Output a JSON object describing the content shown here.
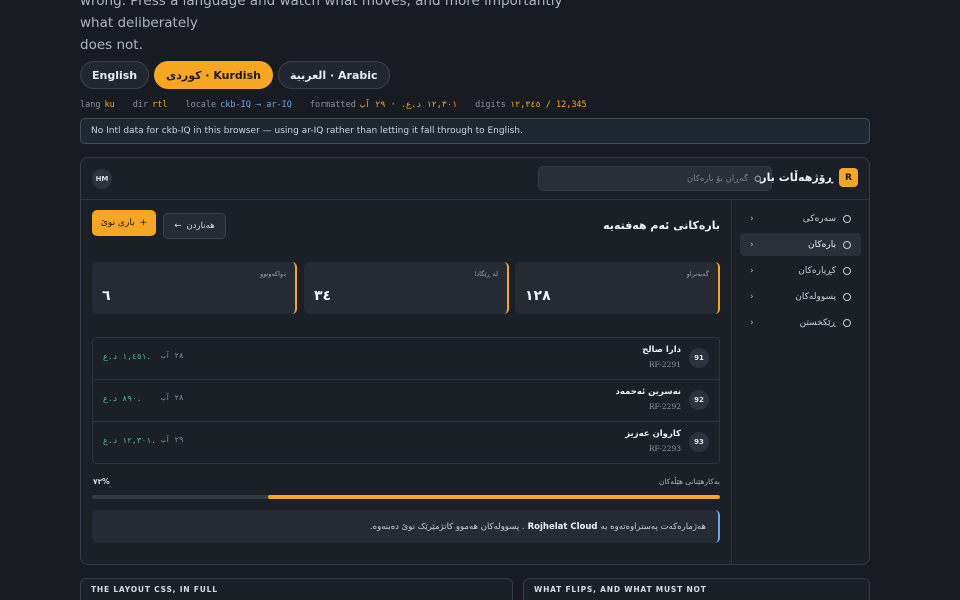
{
  "intro": {
    "line1": "wrong. Press a language and watch what moves, and more importantly what deliberately",
    "line2": "does not."
  },
  "languages": [
    {
      "label": "English",
      "active": false
    },
    {
      "label": "کوردی · Kurdish",
      "active": true
    },
    {
      "label": "العربية · Arabic",
      "active": false
    }
  ],
  "status": {
    "lang_key": "lang",
    "lang_val": "ku",
    "dir_key": "dir",
    "dir_val": "rtl",
    "locale_key": "locale",
    "locale_val": "ckb-IQ → ar-IQ",
    "formatted_key": "formatted",
    "formatted_val": "١٢,٣٠١ د.ع. · ٢٩ آب",
    "digits_key": "digits",
    "digits_val": "١٢,٣٤٥ / 12,345"
  },
  "notice": "No Intl data for ckb-IQ in this browser — using ar-IQ rather than letting it fall through to English.",
  "app": {
    "brand_logo": "R",
    "brand_name": "ڕۆژهەڵات بار",
    "search_placeholder": "گەڕان بۆ بارەکان",
    "avatar": "HM",
    "nav": [
      {
        "label": "سەرەکی",
        "active": false
      },
      {
        "label": "بارەکان",
        "active": true
      },
      {
        "label": "کڕیارەکان",
        "active": false
      },
      {
        "label": "پسوولەکان",
        "active": false
      },
      {
        "label": "ڕێکخستن",
        "active": false
      }
    ],
    "page_title": "بارەکانی ئەم هەفتەیە",
    "new_button": "باری نوێ",
    "export_button": "هەناردن",
    "stats": [
      {
        "label": "گەیەنراو",
        "value": "١٢٨"
      },
      {
        "label": "لە ڕێگادا",
        "value": "٣٤"
      },
      {
        "label": "دواکەوتوو",
        "value": "٦"
      }
    ],
    "rows": [
      {
        "badge": "91",
        "name": "دارا صالح",
        "ref": "RF-2291",
        "date": "٢٨ آب",
        "amount": "١,٤٥١ د.ع."
      },
      {
        "badge": "92",
        "name": "نەسرین ئەحمەد",
        "ref": "RF-2292",
        "date": "٢٨ آب",
        "amount": "٨٩٠ د.ع."
      },
      {
        "badge": "93",
        "name": "کاروان عەزیز",
        "ref": "RF-2293",
        "date": "٢٩ آب",
        "amount": "١٢,٣٠١ د.ع."
      }
    ],
    "progress": {
      "label": "بەکارهێنانی هێڵەکان",
      "percent_text": "٧٢%",
      "value": 0.72
    },
    "info": {
      "before": "هەژمارەکەت پەستراوەتەوە بە",
      "strong": "Rojhelat Cloud",
      "after": ". پسوولەکان هەموو کاتژمێرێک نوێ دەبنەوە."
    }
  },
  "cards": [
    {
      "title": "THE LAYOUT CSS, IN FULL"
    },
    {
      "title": "WHAT FLIPS, AND WHAT MUST NOT"
    }
  ],
  "colors": {
    "accent": "#f5a623",
    "info": "#6aa6f0",
    "money": "#4fc08d"
  }
}
